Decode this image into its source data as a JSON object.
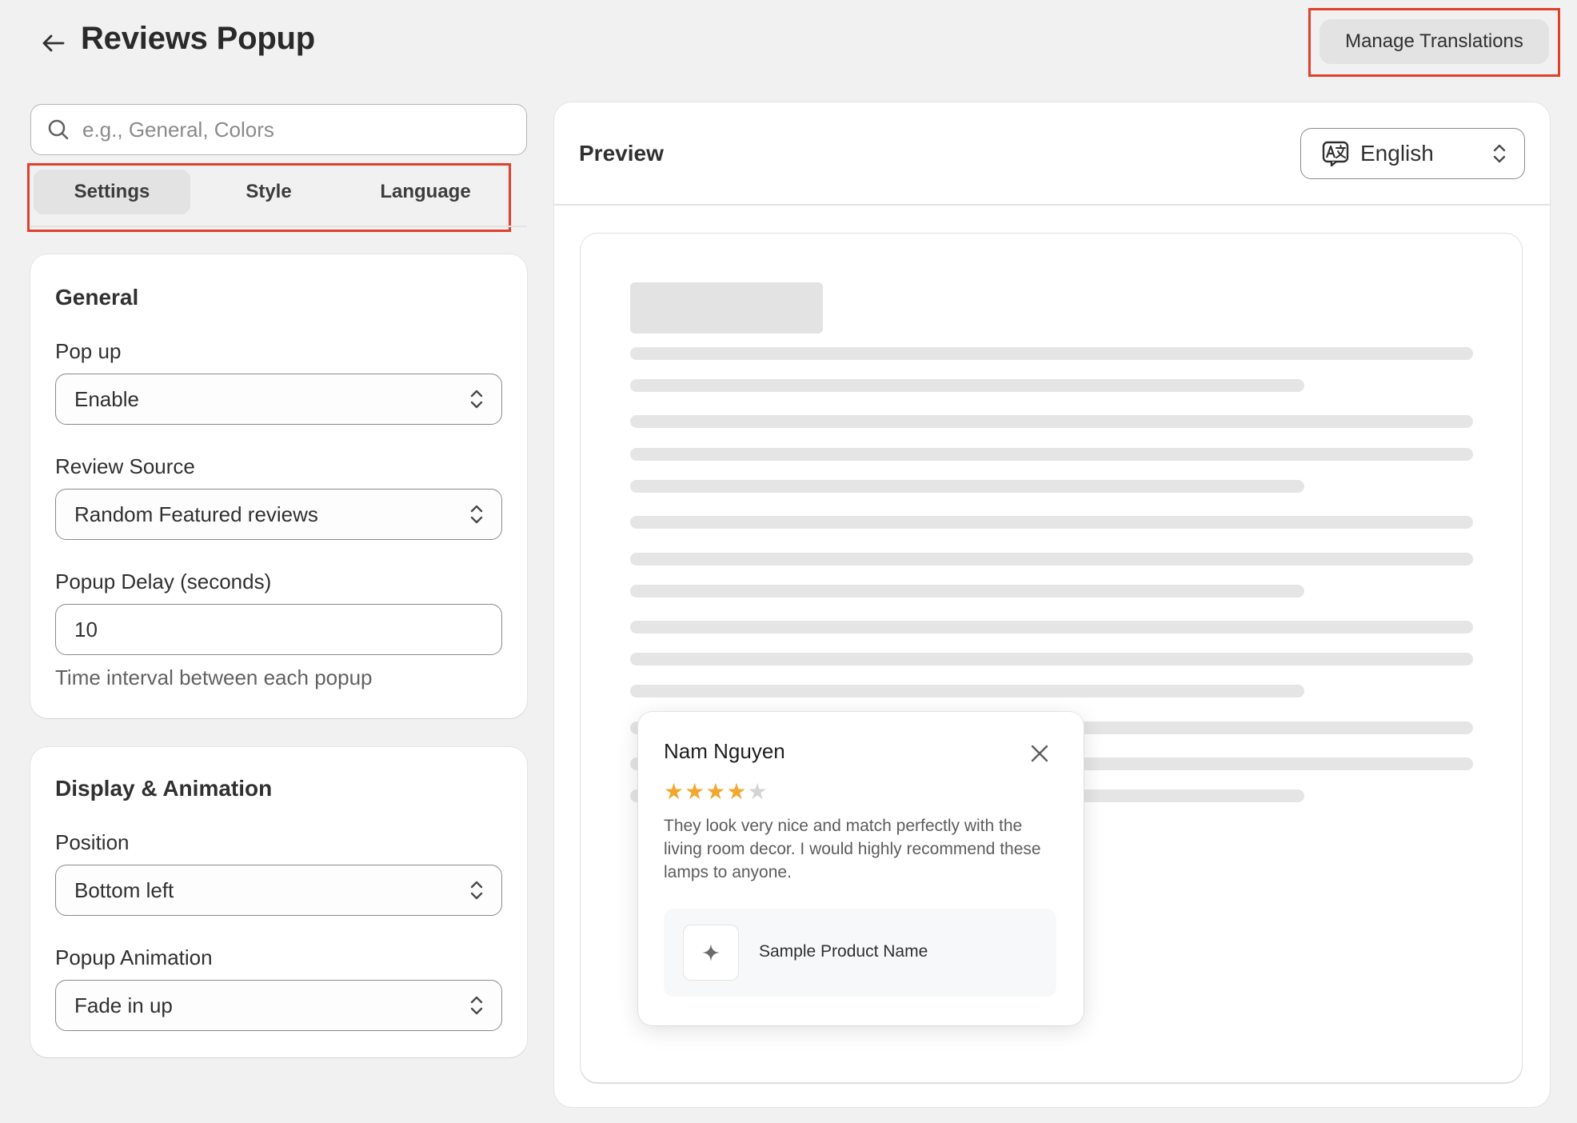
{
  "header": {
    "title": "Reviews Popup",
    "manage_translations_label": "Manage Translations"
  },
  "search": {
    "placeholder": "e.g., General, Colors"
  },
  "tabs": [
    {
      "label": "Settings",
      "active": true
    },
    {
      "label": "Style",
      "active": false
    },
    {
      "label": "Language",
      "active": false
    }
  ],
  "general": {
    "title": "General",
    "popup_label": "Pop up",
    "popup_value": "Enable",
    "source_label": "Review Source",
    "source_value": "Random Featured reviews",
    "delay_label": "Popup Delay (seconds)",
    "delay_value": "10",
    "delay_help": "Time interval between each popup"
  },
  "display": {
    "title": "Display & Animation",
    "position_label": "Position",
    "position_value": "Bottom left",
    "animation_label": "Popup Animation",
    "animation_value": "Fade in up"
  },
  "preview": {
    "title": "Preview",
    "language_value": "English"
  },
  "popup": {
    "reviewer_name": "Nam Nguyen",
    "rating": 4,
    "rating_max": 5,
    "review_text": "They look very nice and match perfectly with the living room decor. I would highly recommend these lamps to anyone.",
    "product_name": "Sample Product Name"
  },
  "colors": {
    "highlight_border": "#e0402c",
    "star_filled": "#f0a830",
    "star_empty": "#d4d4d4",
    "background": "#f1f1f1"
  },
  "icons": [
    "arrow-left-icon",
    "search-icon",
    "chevron-up-down-icon",
    "translate-icon",
    "close-icon",
    "sparkle-icon",
    "star-icon"
  ]
}
